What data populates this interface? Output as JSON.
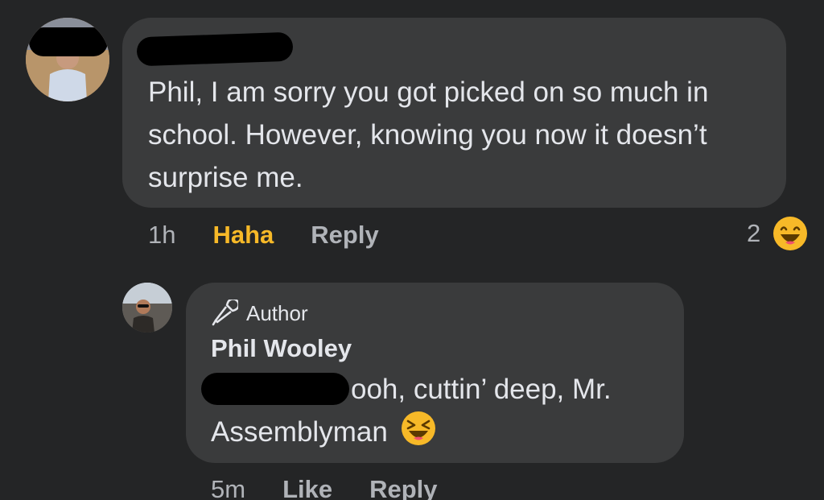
{
  "comment": {
    "text": "Phil, I am sorry you got picked on so much in school. However, knowing you now it doesn’t surprise me.",
    "time": "1h",
    "reaction_label": "Haha",
    "reply_label": "Reply",
    "reaction_count": "2",
    "reaction_icon": "haha-emoji-icon"
  },
  "reply": {
    "badge_label": "Author",
    "badge_icon": "microphone-icon",
    "author_name": "Phil Wooley",
    "text": "ooh, cuttin’ deep, Mr. Assemblyman",
    "emoji": "laughing-squint-emoji-icon",
    "time": "5m",
    "like_label": "Like",
    "reply_label": "Reply"
  },
  "colors": {
    "background": "#242526",
    "bubble": "#3a3b3c",
    "text": "#e4e6eb",
    "muted": "#b0b3b8",
    "haha": "#f7b928"
  }
}
